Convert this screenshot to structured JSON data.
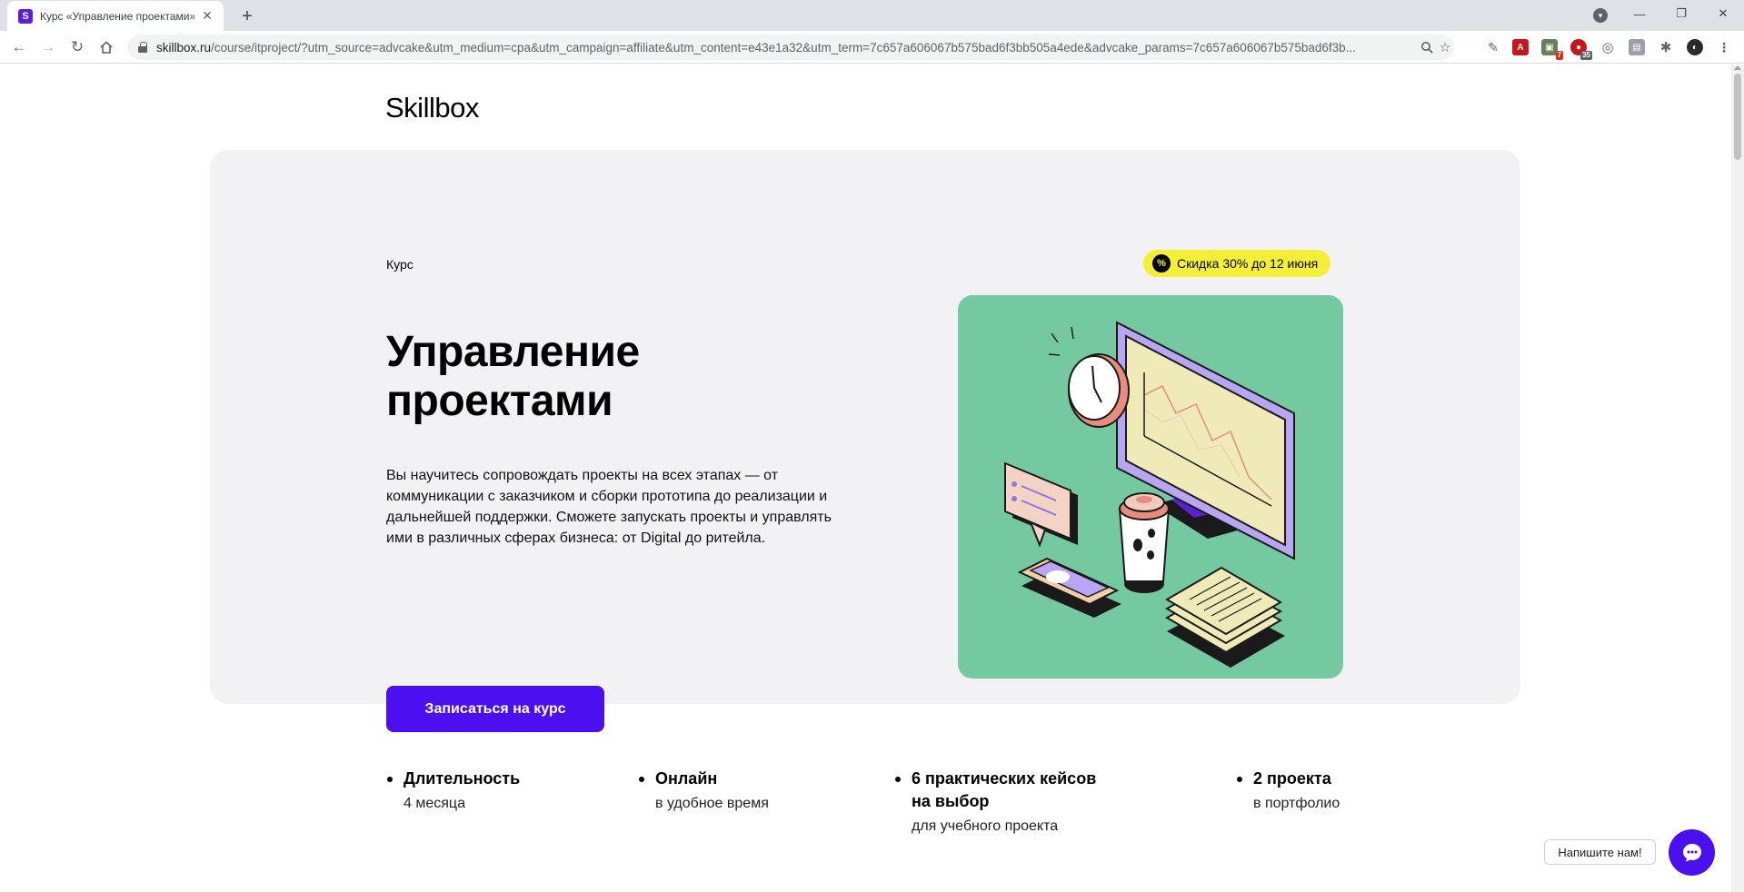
{
  "browser": {
    "tab_title": "Курс «Управление проектами»",
    "favicon_letter": "S",
    "new_tab": "+",
    "url_host": "skillbox.ru",
    "url_path": "/course/itproject/?utm_source=advcake&utm_medium=cpa&utm_campaign=affiliate&utm_content=e43e1a32&utm_term=7c657a606067b575bad6f3bb505a4ede&advcake_params=7c657a606067b575bad6f3b...",
    "ext_badge_1": "7",
    "ext_badge_2": "35"
  },
  "page": {
    "logo": "Skillbox",
    "kicker": "Курс",
    "discount": "Скидка 30% до 12 июня",
    "discount_icon": "%",
    "title": "Управление проектами",
    "description": "Вы научитесь сопровождать проекты на всех этапах — от коммуникации с заказчиком и сборки прототипа до реализации и дальнейшей поддержки. Сможете запускать проекты и управлять ими в различных сферах бизнеса: от Digital до ритейла.",
    "cta": "Записаться на курс",
    "features": [
      {
        "title": "Длительность",
        "subtitle": "4 месяца"
      },
      {
        "title": "Онлайн",
        "subtitle": "в удобное время"
      },
      {
        "title": "6 практических кейсов на выбор",
        "subtitle": "для учебного проекта"
      },
      {
        "title": "2 проекта",
        "subtitle": "в портфолио"
      }
    ],
    "chat_label": "Напишите нам!"
  },
  "colors": {
    "accent": "#4b0ff0",
    "hero_bg": "#f2f2f4",
    "discount_bg": "#f5f037",
    "illustration_bg": "#75c9a1"
  }
}
